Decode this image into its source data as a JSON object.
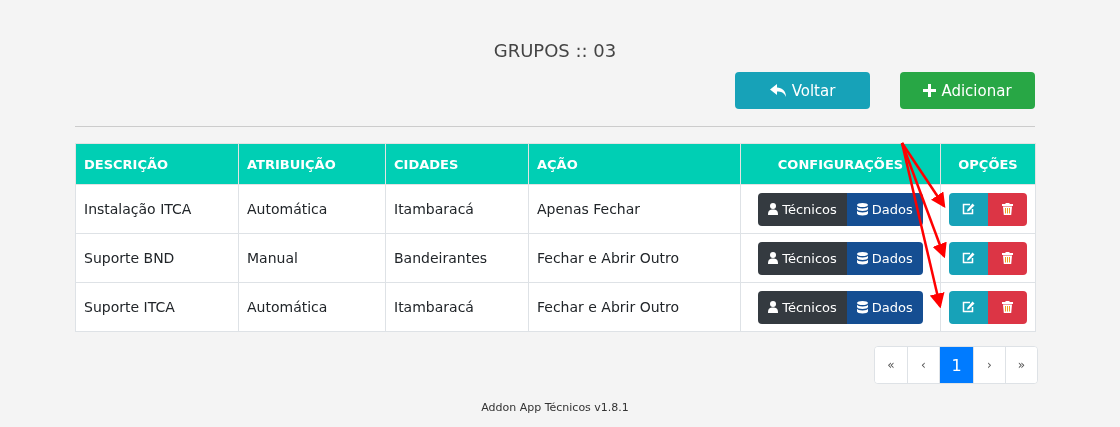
{
  "title": "GRUPOS :: 03",
  "actions": [
    {
      "kind": "back",
      "label": "Voltar"
    },
    {
      "kind": "add",
      "label": "Adicionar"
    }
  ],
  "table": {
    "columns": [
      "DESCRIÇÃO",
      "ATRIBUIÇÃO",
      "CIDADES",
      "AÇÃO",
      "CONFIGURAÇÕES",
      "OPÇÕES"
    ],
    "rows": [
      {
        "cells": [
          "Instalação ITCA",
          "Automática",
          "Itambaracá",
          "Apenas Fechar"
        ],
        "buttons": [
          "Técnicos",
          "Dados"
        ]
      },
      {
        "cells": [
          "Suporte BND",
          "Manual",
          "Bandeirantes",
          "Fechar e Abrir Outro"
        ],
        "buttons": [
          "Técnicos",
          "Dados"
        ]
      },
      {
        "cells": [
          "Suporte ITCA",
          "Automática",
          "Itambaracá",
          "Fechar e Abrir Outro"
        ],
        "buttons": [
          "Técnicos",
          "Dados"
        ]
      }
    ]
  },
  "pagination": [
    {
      "label": "«",
      "selected": false
    },
    {
      "label": "‹",
      "selected": false
    },
    {
      "label": "1",
      "selected": true
    },
    {
      "label": "›",
      "selected": false
    },
    {
      "label": "»",
      "selected": false
    }
  ],
  "footer": "Addon App Técnicos v1.8.1"
}
